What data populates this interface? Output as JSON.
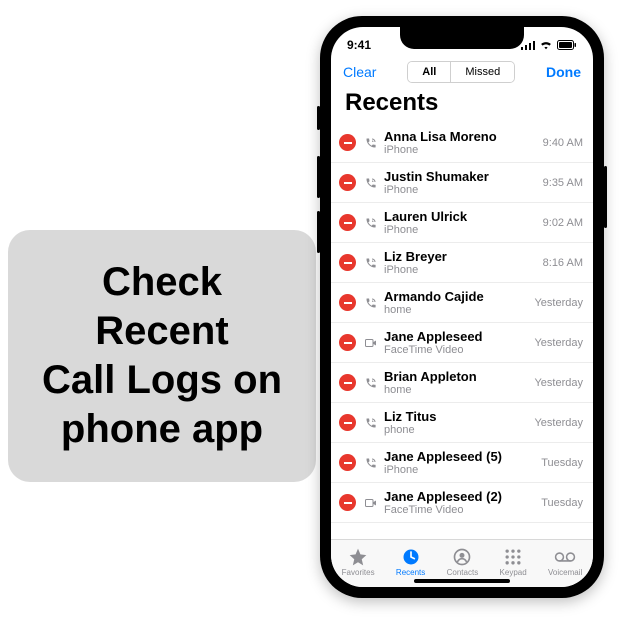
{
  "caption": "Check\nRecent\nCall Logs on\nphone app",
  "status": {
    "time": "9:41"
  },
  "nav": {
    "left": "Clear",
    "right": "Done",
    "seg_all": "All",
    "seg_missed": "Missed"
  },
  "header": {
    "title": "Recents"
  },
  "calls": [
    {
      "name": "Anna Lisa Moreno",
      "sub": "iPhone",
      "time": "9:40 AM",
      "icon": "phone"
    },
    {
      "name": "Justin Shumaker",
      "sub": "iPhone",
      "time": "9:35 AM",
      "icon": "phone"
    },
    {
      "name": "Lauren Ulrick",
      "sub": "iPhone",
      "time": "9:02 AM",
      "icon": "phone"
    },
    {
      "name": "Liz Breyer",
      "sub": "iPhone",
      "time": "8:16 AM",
      "icon": "phone"
    },
    {
      "name": "Armando Cajide",
      "sub": "home",
      "time": "Yesterday",
      "icon": "phone"
    },
    {
      "name": "Jane Appleseed",
      "sub": "FaceTime Video",
      "time": "Yesterday",
      "icon": "facetime"
    },
    {
      "name": "Brian Appleton",
      "sub": "home",
      "time": "Yesterday",
      "icon": "phone"
    },
    {
      "name": "Liz Titus",
      "sub": "phone",
      "time": "Yesterday",
      "icon": "phone"
    },
    {
      "name": "Jane Appleseed (5)",
      "sub": "iPhone",
      "time": "Tuesday",
      "icon": "phone"
    },
    {
      "name": "Jane Appleseed (2)",
      "sub": "FaceTime Video",
      "time": "Tuesday",
      "icon": "facetime"
    }
  ],
  "tabs": {
    "favorites": "Favorites",
    "recents": "Recents",
    "contacts": "Contacts",
    "keypad": "Keypad",
    "voicemail": "Voicemail"
  }
}
